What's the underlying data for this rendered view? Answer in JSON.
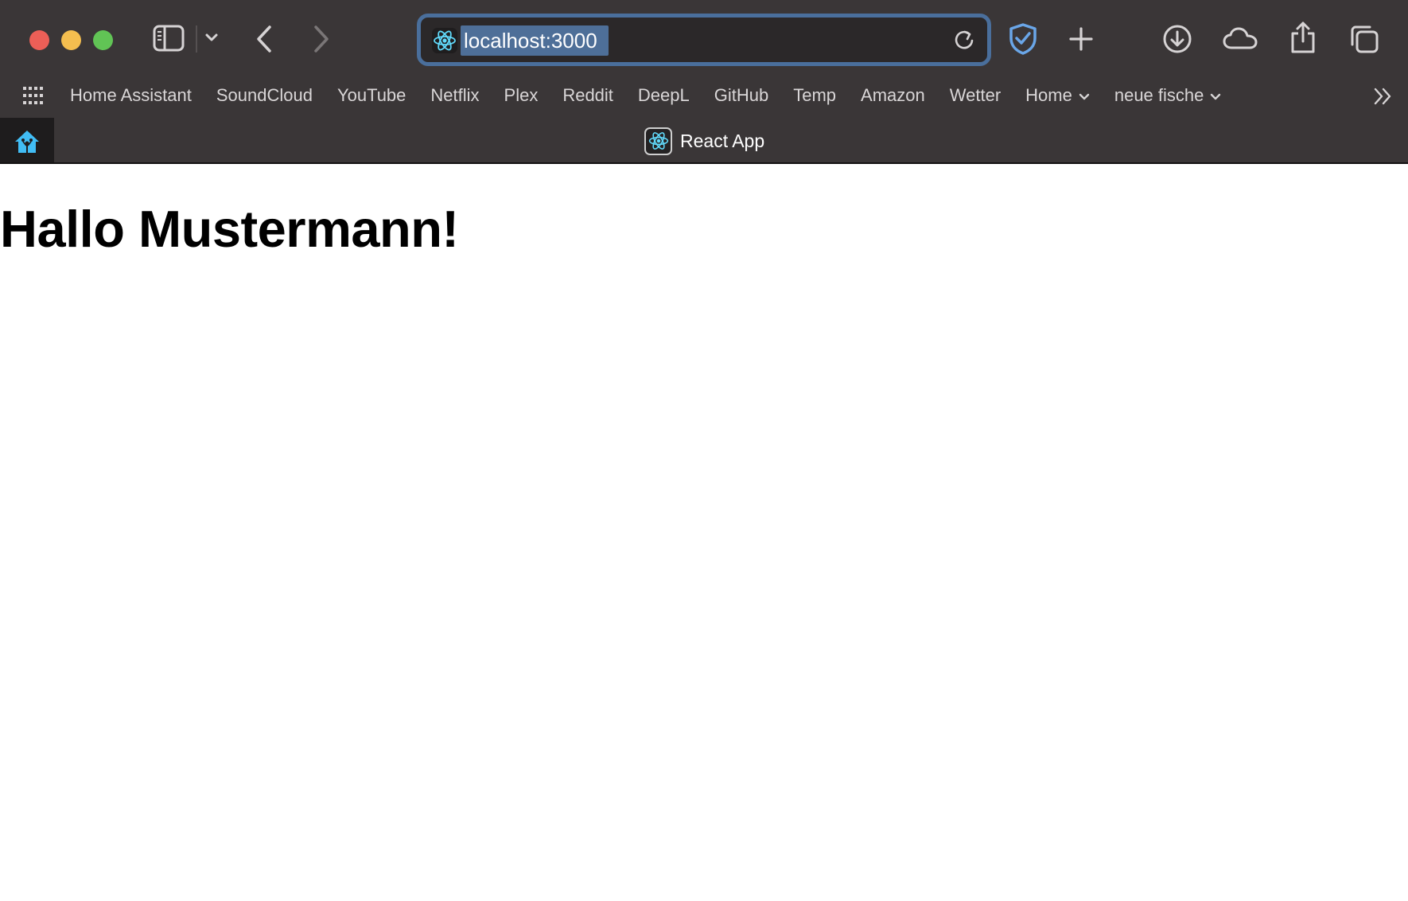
{
  "window": {
    "traffic_lights": {
      "close_color": "#ec5f57",
      "minimize_color": "#f4be4f",
      "maximize_color": "#61c455"
    }
  },
  "toolbar": {
    "url": "localhost:3000",
    "url_selection_color": "#4e6f98",
    "focus_ring_color": "#4a6f9c",
    "shield_color": "#6aa6e8"
  },
  "bookmarks": {
    "items": [
      {
        "label": "Home Assistant"
      },
      {
        "label": "SoundCloud"
      },
      {
        "label": "YouTube"
      },
      {
        "label": "Netflix"
      },
      {
        "label": "Plex"
      },
      {
        "label": "Reddit"
      },
      {
        "label": "DeepL"
      },
      {
        "label": "GitHub"
      },
      {
        "label": "Temp"
      },
      {
        "label": "Amazon"
      },
      {
        "label": "Wetter"
      }
    ],
    "folders": [
      {
        "label": "Home"
      },
      {
        "label": "neue fische"
      }
    ]
  },
  "tabs": {
    "active_title": "React App"
  },
  "page": {
    "heading": "Hallo Mustermann!"
  }
}
